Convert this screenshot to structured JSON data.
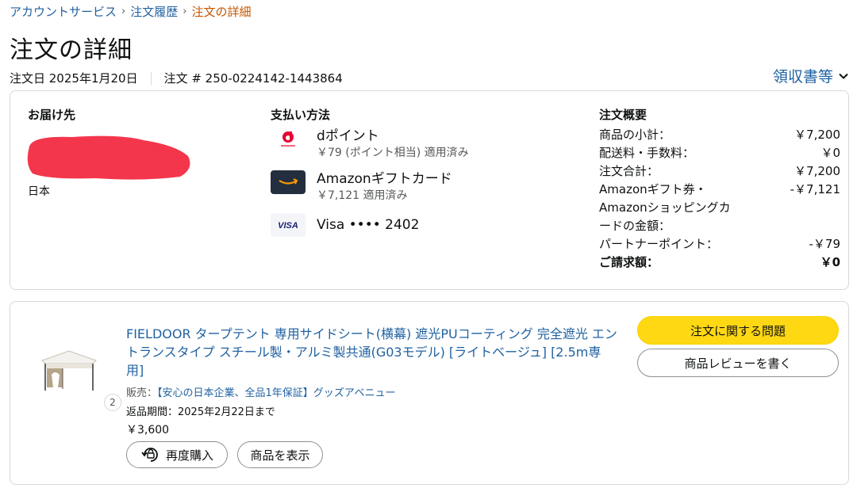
{
  "breadcrumb": {
    "items": [
      "アカウントサービス",
      "注文履歴"
    ],
    "current": "注文の詳細",
    "separator": "›"
  },
  "page_title": "注文の詳細",
  "meta": {
    "order_date": "注文日 2025年1月20日",
    "order_number": "注文 # 250-0224142-1443864"
  },
  "receipts_label": "領収書等",
  "shipping": {
    "title": "お届け先",
    "country": "日本"
  },
  "payment": {
    "title": "支払い方法",
    "methods": [
      {
        "icon": "d-point-icon",
        "name": "dポイント",
        "detail": "￥79 (ポイント相当) 適用済み"
      },
      {
        "icon": "amazon-gift-card-icon",
        "name": "Amazonギフトカード",
        "detail": "￥7,121 適用済み"
      },
      {
        "icon": "visa-icon",
        "name": "Visa •••• 2402",
        "detail": ""
      }
    ]
  },
  "summary": {
    "title": "注文概要",
    "rows": [
      {
        "label": "商品の小計：",
        "amount": "￥7,200"
      },
      {
        "label": "配送料・手数料：",
        "amount": "￥0"
      },
      {
        "label": "注文合計：",
        "amount": "￥7,200"
      },
      {
        "label": "Amazonギフト券・Amazonショッピングカードの金額：",
        "amount": "-￥7,121"
      },
      {
        "label": "パートナーポイント：",
        "amount": "-￥79"
      },
      {
        "label": "ご請求額：",
        "amount": "￥0"
      }
    ]
  },
  "item": {
    "title": "FIELDOOR タープテント 専用サイドシート(横幕) 遮光PUコーティング 完全遮光 エントランスタイプ スチール製・アルミ製共通(G03モデル) [ライトベージュ] [2.5m専用]",
    "seller_label": "販売：",
    "seller_name": "【安心の日本企業、全品1年保証】グッズアベニュー",
    "return_period": "返品期間：2025年2月22日まで",
    "price": "￥3,600",
    "quantity": "2",
    "rebuy_label": "再度購入",
    "view_label": "商品を表示",
    "problem_label": "注文に関する問題",
    "review_label": "商品レビューを書く"
  },
  "colors": {
    "link": "#2162a1",
    "accent_orange": "#c45500",
    "button_yellow": "#ffd814",
    "redaction": "#f4364c"
  }
}
